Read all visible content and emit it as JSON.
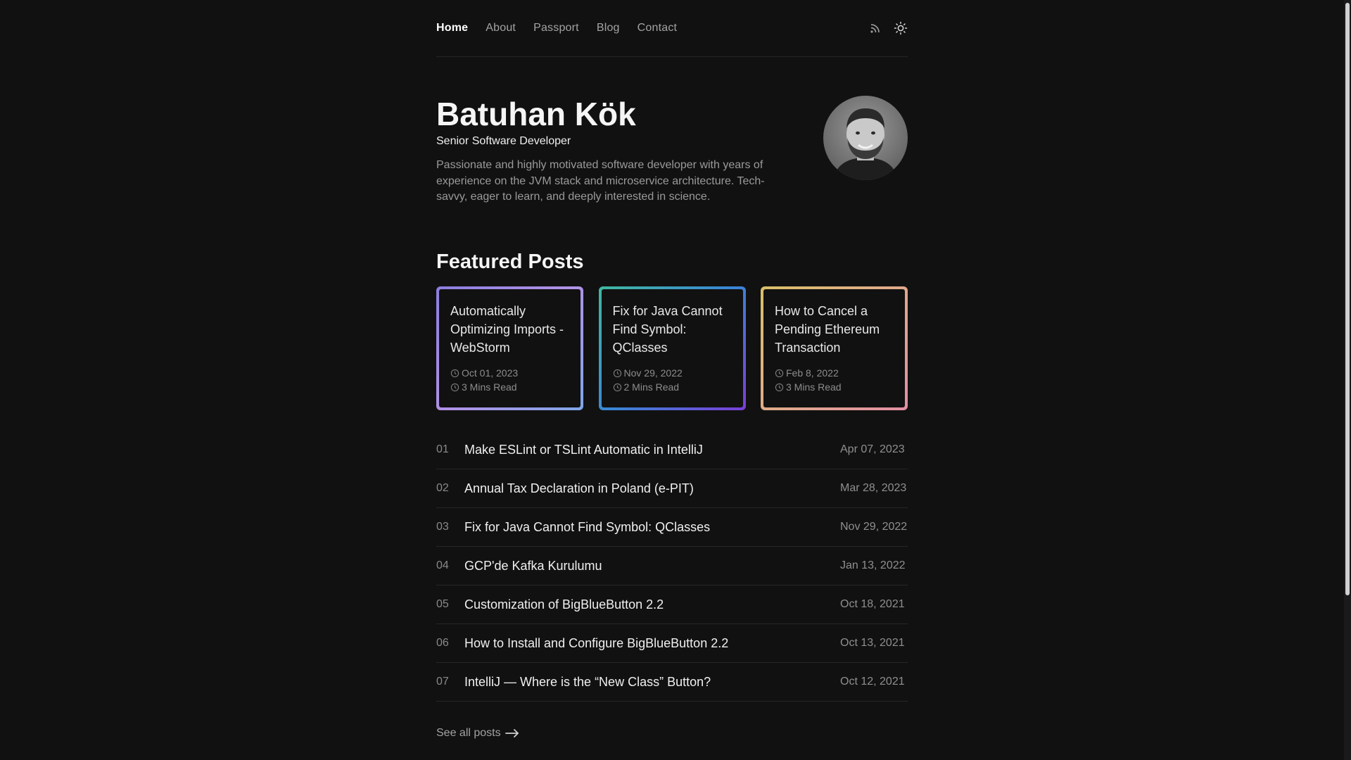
{
  "nav": {
    "links": [
      {
        "label": "Home",
        "active": true
      },
      {
        "label": "About"
      },
      {
        "label": "Passport"
      },
      {
        "label": "Blog"
      },
      {
        "label": "Contact"
      }
    ],
    "icons": [
      "rss-icon",
      "sun-icon"
    ]
  },
  "hero": {
    "name": "Batuhan Kök",
    "role": "Senior Software Developer",
    "description": "Passionate and highly motivated software developer with years of experience on the JVM stack and microservice architecture. Tech-savvy, eager to learn, and deeply interested in science."
  },
  "featured": {
    "title": "Featured Posts",
    "cards": [
      {
        "title": "Automatically Optimizing Imports - WebStorm",
        "date": "Oct 01, 2023",
        "read": "3 Mins Read"
      },
      {
        "title": "Fix for Java Cannot Find Symbol: QClasses",
        "date": "Nov 29, 2022",
        "read": "2 Mins Read"
      },
      {
        "title": "How to Cancel a Pending Ethereum Transaction",
        "date": "Feb 8, 2022",
        "read": "3 Mins Read"
      }
    ]
  },
  "posts": [
    {
      "num": "01",
      "title": "Make ESLint or TSLint Automatic in IntelliJ",
      "date": "Apr 07, 2023"
    },
    {
      "num": "02",
      "title": "Annual Tax Declaration in Poland (e-PIT)",
      "date": "Mar 28, 2023"
    },
    {
      "num": "03",
      "title": "Fix for Java Cannot Find Symbol: QClasses",
      "date": "Nov 29, 2022"
    },
    {
      "num": "04",
      "title": "GCP'de Kafka Kurulumu",
      "date": "Jan 13, 2022"
    },
    {
      "num": "05",
      "title": "Customization of BigBlueButton 2.2",
      "date": "Oct 18, 2021"
    },
    {
      "num": "06",
      "title": "How to Install and Configure BigBlueButton 2.2",
      "date": "Oct 13, 2021"
    },
    {
      "num": "07",
      "title": "IntelliJ — Where is the “New Class” Button?",
      "date": "Oct 12, 2021"
    }
  ],
  "see_all": "See all posts"
}
